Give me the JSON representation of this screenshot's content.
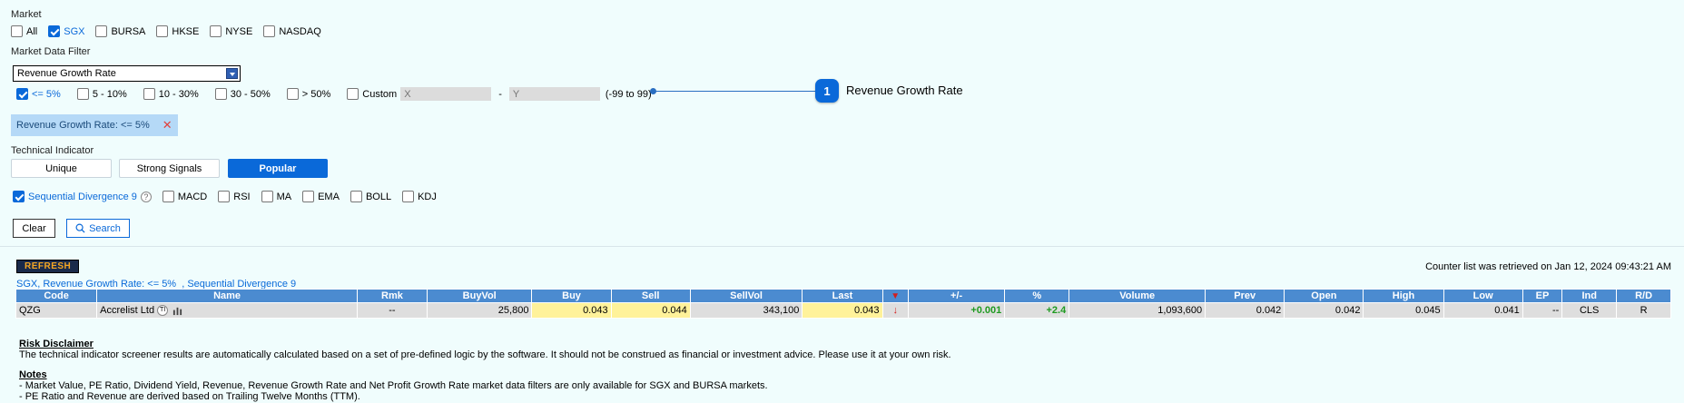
{
  "market": {
    "label": "Market",
    "options": [
      {
        "label": "All",
        "checked": false
      },
      {
        "label": "SGX",
        "checked": true
      },
      {
        "label": "BURSA",
        "checked": false
      },
      {
        "label": "HKSE",
        "checked": false
      },
      {
        "label": "NYSE",
        "checked": false
      },
      {
        "label": "NASDAQ",
        "checked": false
      }
    ]
  },
  "filter": {
    "label": "Market Data Filter",
    "selected": "Revenue Growth Rate",
    "ranges": [
      "<= 5%",
      "5 - 10%",
      "10 - 30%",
      "30 - 50%",
      "> 50%"
    ],
    "custom_label": "Custom",
    "x_placeholder": "X",
    "dash": "-",
    "y_placeholder": "Y",
    "hint": "(-99 to 99)",
    "active_tag": "Revenue Growth Rate: <= 5%",
    "remove_icon": "✕"
  },
  "callout": {
    "number": "1",
    "text": "Revenue Growth Rate"
  },
  "technical": {
    "label": "Technical Indicator",
    "segments": [
      "Unique",
      "Strong Signals",
      "Popular"
    ],
    "indicators": [
      "Sequential Divergence 9",
      "MACD",
      "RSI",
      "MA",
      "EMA",
      "BOLL",
      "KDJ"
    ],
    "help_icon": "?"
  },
  "actions": {
    "clear": "Clear",
    "search": "Search"
  },
  "results": {
    "refresh": "REFRESH",
    "retrieved": "Counter list was retrieved on Jan 12, 2024 09:43:21 AM",
    "criteria": "SGX, Revenue Growth Rate: <= 5%  , Sequential Divergence 9",
    "columns": [
      "Code",
      "Name",
      "Rmk",
      "BuyVol",
      "Buy",
      "Sell",
      "SellVol",
      "Last",
      "",
      "+/-",
      "%",
      "Volume",
      "Prev",
      "Open",
      "High",
      "Low",
      "EP",
      "Ind",
      "R/D"
    ],
    "row": {
      "code": "QZG",
      "name": "Accrelist Ltd",
      "ti": "TI",
      "rmk": "--",
      "buyvol": "25,800",
      "buy": "0.043",
      "sell": "0.044",
      "sellvol": "343,100",
      "last": "0.043",
      "arrow": "↓",
      "change": "+0.001",
      "pct": "+2.4",
      "volume": "1,093,600",
      "prev": "0.042",
      "open": "0.042",
      "high": "0.045",
      "low": "0.041",
      "ep": "--",
      "ind": "CLS",
      "rd": "R"
    }
  },
  "disclaimer": {
    "title": "Risk Disclaimer",
    "text": "The technical indicator screener results are automatically calculated based on a set of pre-defined logic by the software. It should not be construed as financial or investment advice. Please use it at your own risk."
  },
  "notes": {
    "title": "Notes",
    "items": [
      "- Market Value, PE Ratio, Dividend Yield, Revenue, Revenue Growth Rate and Net Profit Growth Rate market data filters are only available for SGX and BURSA markets.",
      "- PE Ratio and Revenue are derived based on Trailing Twelve Months (TTM)."
    ]
  },
  "colors": {
    "accent": "#0a69d9",
    "header": "#4b8bd0",
    "highlight": "#fff29a",
    "up": "#1e9a20",
    "down": "#d21e1e"
  }
}
